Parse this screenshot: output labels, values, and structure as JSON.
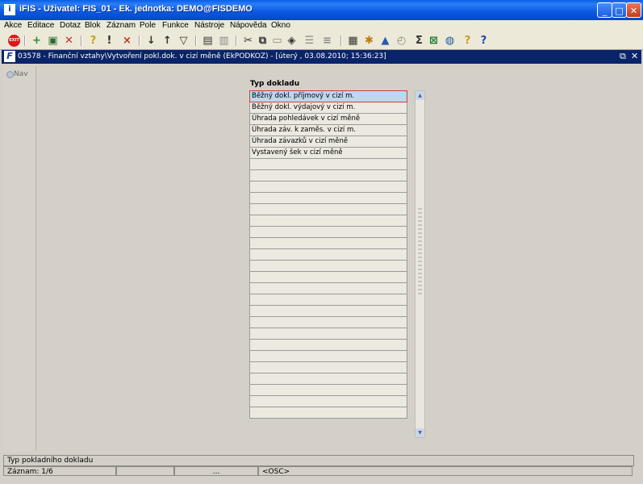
{
  "window": {
    "title": "iFIS - Uživatel: FIS_01 - Ek. jednotka: DEMO@FISDEMO",
    "minimize": "_",
    "maximize": "□",
    "close": "✕"
  },
  "menu": [
    "Akce",
    "Editace",
    "Dotaz",
    "Blok",
    "Záznam",
    "Pole",
    "Funkce",
    "Nástroje",
    "Nápověda",
    "Okno"
  ],
  "toolbar": {
    "exit_label": "EXIT",
    "icons": [
      "new-record-icon",
      "open-icon",
      "delete-icon",
      "enter-query-icon",
      "execute-query-icon",
      "cancel-query-icon",
      "sort-asc-icon",
      "sort-desc-icon",
      "filter-icon",
      "print-icon",
      "print-preview-icon",
      "cut-icon",
      "copy-icon",
      "paste-icon",
      "lov-icon",
      "columns-icon",
      "rows-icon",
      "calculator-icon",
      "settings-icon",
      "chart-icon",
      "clock-icon",
      "sum-icon",
      "excel-icon",
      "web-icon",
      "help-icon",
      "about-icon"
    ]
  },
  "form": {
    "app_icon": "F",
    "title": "03578 - Finanční vztahy\\Vytvoření pokl.dok. v cizí měně (EkPODKOZ) - [úterý  , 03.08.2010; 15:36:23]",
    "nav_label": "Nav",
    "column_header": "Typ dokladu",
    "rows": [
      "Běžný dokl. příjmový v cizí m.",
      "Běžný dokl. výdajový v cizí m.",
      "Úhrada pohledávek v cizí měně",
      "Úhrada záv. k zaměs. v cizí m.",
      "Úhrada závazků v cizí měně",
      "Vystavený šek v cizí měně",
      "",
      "",
      "",
      "",
      "",
      "",
      "",
      "",
      "",
      "",
      "",
      "",
      "",
      "",
      "",
      "",
      "",
      "",
      "",
      "",
      "",
      "",
      ""
    ],
    "selected_row": 0
  },
  "status": {
    "hint": "Typ pokladního dokladu",
    "record": "Záznam: 1/6",
    "ellipsis": "...",
    "mode": "<OSC>"
  }
}
